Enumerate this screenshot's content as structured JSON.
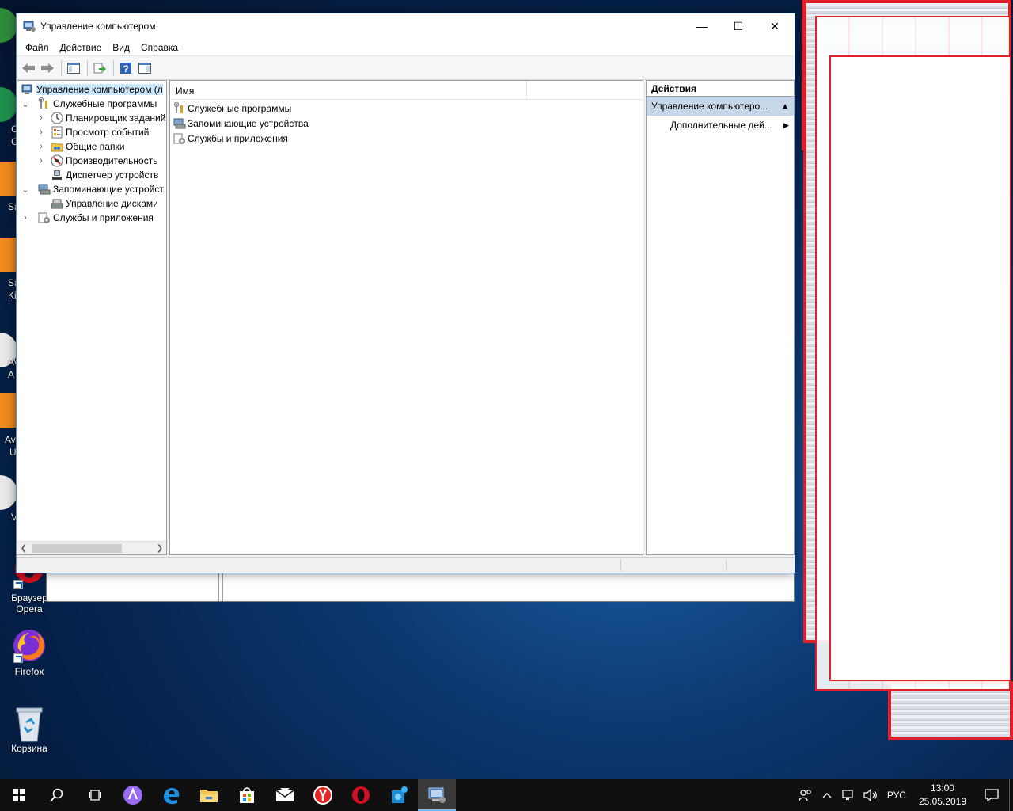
{
  "window": {
    "title": "Управление компьютером",
    "controls": {
      "minimize": "—",
      "maximize": "☐",
      "close": "✕"
    }
  },
  "menu": [
    "Файл",
    "Действие",
    "Вид",
    "Справка"
  ],
  "tree": {
    "root": "Управление компьютером (л",
    "items": [
      {
        "label": "Служебные программы",
        "level": 1,
        "expander": "⌄"
      },
      {
        "label": "Планировщик заданий",
        "level": 2,
        "expander": "›"
      },
      {
        "label": "Просмотр событий",
        "level": 2,
        "expander": "›"
      },
      {
        "label": "Общие папки",
        "level": 2,
        "expander": "›"
      },
      {
        "label": "Производительность",
        "level": 2,
        "expander": "›"
      },
      {
        "label": "Диспетчер устройств",
        "level": 2,
        "expander": ""
      },
      {
        "label": "Запоминающие устройст",
        "level": 1,
        "expander": "⌄"
      },
      {
        "label": "Управление дисками",
        "level": 2,
        "expander": ""
      },
      {
        "label": "Службы и приложения",
        "level": 1,
        "expander": "›"
      }
    ]
  },
  "center": {
    "column_name": "Имя",
    "rows": [
      "Служебные программы",
      "Запоминающие устройства",
      "Службы и приложения"
    ]
  },
  "actions": {
    "header": "Действия",
    "section": "Управление компьютеро...",
    "item": "Дополнительные дей..."
  },
  "desktop": {
    "icons": [
      {
        "label_line1": "Браузер",
        "label_line2": "Opera"
      },
      {
        "label_line1": "Firefox",
        "label_line2": ""
      },
      {
        "label_line1": "Корзина",
        "label_line2": ""
      }
    ],
    "partial_labels": [
      "C",
      "C",
      "Sa",
      "Sa",
      "Ki",
      "Av",
      "A",
      "Av",
      "U",
      "V"
    ]
  },
  "taskbar": {
    "language": "РУС",
    "time": "13:00",
    "date": "25.05.2019"
  },
  "colors": {
    "accent_selection": "#cce8ff",
    "actions_section_bg": "#c7d7ea",
    "ghost_border": "#e0202a",
    "taskbar_bg": "#101010"
  }
}
